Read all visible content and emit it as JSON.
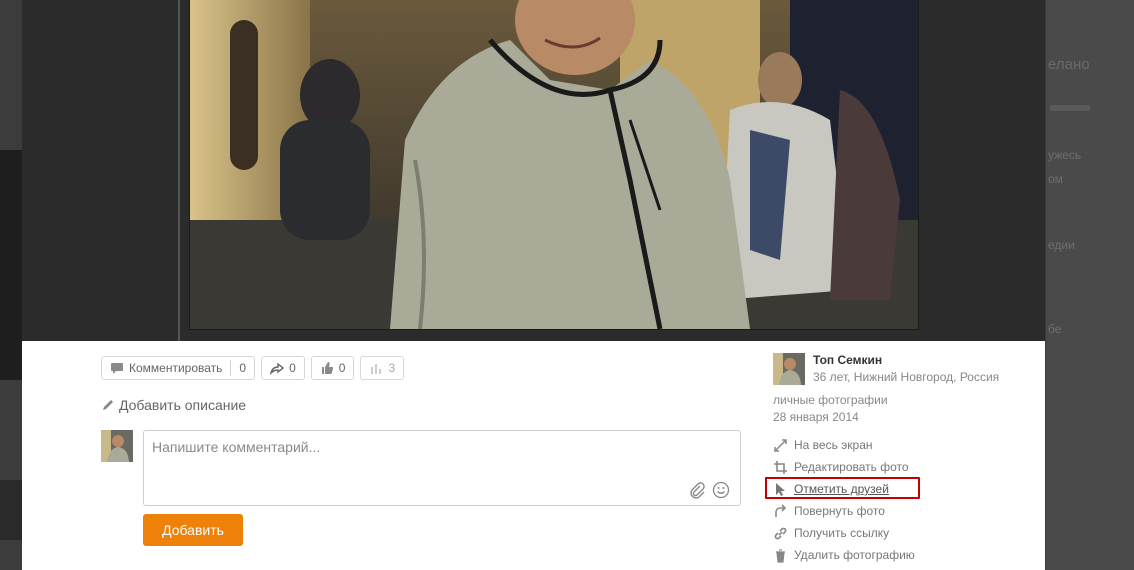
{
  "background": {
    "right_title": "елано",
    "right_snippets": [
      "ужесь",
      "ом",
      "едии",
      "бе"
    ]
  },
  "actions": {
    "comment_label": "Комментировать",
    "comment_count": "0",
    "share_count": "0",
    "like_count": "0",
    "stats_count": "3"
  },
  "description": {
    "add_label": "Добавить описание"
  },
  "comment": {
    "placeholder": "Напишите комментарий...",
    "submit_label": "Добавить"
  },
  "author": {
    "name": "Топ Семкин",
    "info": "36 лет, Нижний Новгород, Россия",
    "album": "личные фотографии",
    "date": "28 января 2014"
  },
  "menu": {
    "fullscreen": "На весь экран",
    "edit": "Редактировать фото",
    "tag_friends": "Отметить друзей",
    "rotate": "Повернуть фото",
    "get_link": "Получить ссылку",
    "delete": "Удалить фотографию"
  },
  "colors": {
    "accent": "#ee8208",
    "highlight": "#c40000"
  }
}
